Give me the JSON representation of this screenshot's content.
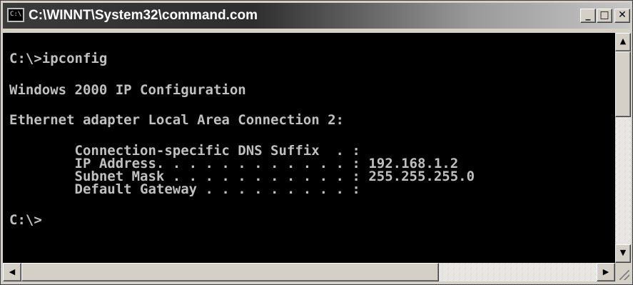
{
  "window": {
    "title": "C:\\WINNT\\System32\\command.com",
    "icon": "console-icon",
    "icon_text": "C:\\",
    "buttons": {
      "minimize": "_",
      "maximize": "□",
      "close": "✕"
    }
  },
  "console": {
    "lines": {
      "prompt1": "C:\\>ipconfig",
      "heading": "Windows 2000 IP Configuration",
      "adapter": "Ethernet adapter Local Area Connection 2:",
      "dns": "        Connection-specific DNS Suffix  . :",
      "ip": "        IP Address. . . . . . . . . . . . : 192.168.1.2",
      "mask": "        Subnet Mask . . . . . . . . . . . : 255.255.255.0",
      "gateway": "        Default Gateway . . . . . . . . . :",
      "prompt2": "C:\\>"
    },
    "colors": {
      "background": "#000000",
      "text": "#c0c0c0"
    }
  },
  "scrollbars": {
    "up": "▲",
    "down": "▼",
    "left": "◀",
    "right": "▶"
  }
}
